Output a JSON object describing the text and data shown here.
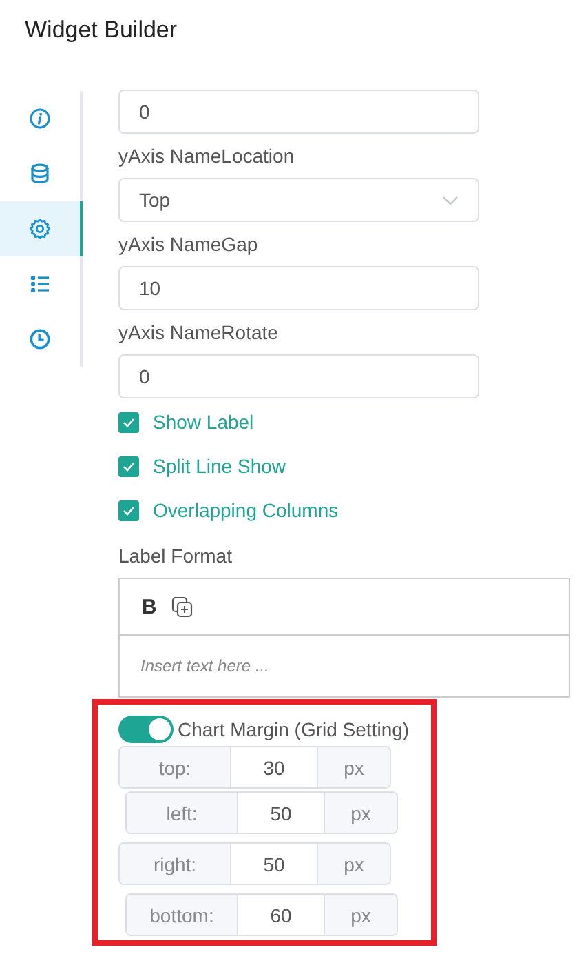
{
  "title": "Widget Builder",
  "sidebar": {
    "items": [
      {
        "kind": "info",
        "selected": false
      },
      {
        "kind": "database",
        "selected": false
      },
      {
        "kind": "settings",
        "selected": true
      },
      {
        "kind": "list",
        "selected": false
      },
      {
        "kind": "clock",
        "selected": false
      }
    ]
  },
  "form": {
    "top_field": {
      "value": "0"
    },
    "name_location": {
      "label": "yAxis NameLocation",
      "value": "Top"
    },
    "name_gap": {
      "label": "yAxis NameGap",
      "value": "10"
    },
    "name_rotate": {
      "label": "yAxis NameRotate",
      "value": "0"
    },
    "checkboxes": [
      {
        "label": "Show Label",
        "checked": true
      },
      {
        "label": "Split Line Show",
        "checked": true
      },
      {
        "label": "Overlapping Columns",
        "checked": true
      }
    ],
    "label_format": {
      "label": "Label Format",
      "bold": "B",
      "placeholder": "Insert text here ..."
    },
    "chart_margin": {
      "label": "Chart Margin (Grid Setting)",
      "on": true,
      "rows": [
        {
          "label": "top:",
          "value": "30",
          "unit": "px"
        },
        {
          "label": "left:",
          "value": "50",
          "unit": "px"
        },
        {
          "label": "right:",
          "value": "50",
          "unit": "px"
        },
        {
          "label": "bottom:",
          "value": "60",
          "unit": "px"
        }
      ]
    }
  }
}
